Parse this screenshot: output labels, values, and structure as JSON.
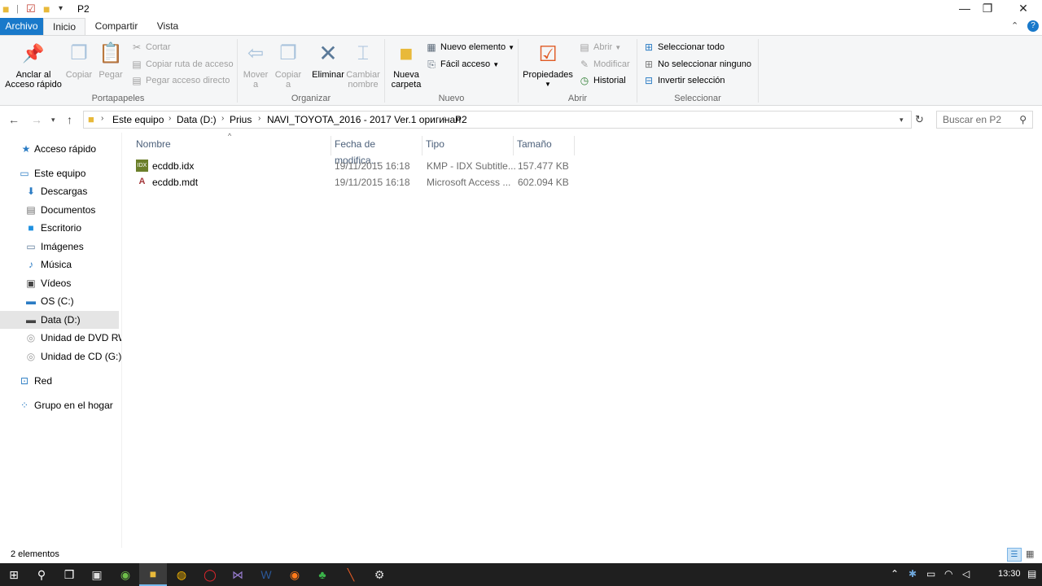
{
  "window": {
    "title": "P2",
    "minimize_icon": "minimize-icon",
    "maximize_icon": "restore-icon",
    "close_icon": "close-icon"
  },
  "tabs": [
    {
      "label": "Archivo"
    },
    {
      "label": "Inicio"
    },
    {
      "label": "Compartir"
    },
    {
      "label": "Vista"
    }
  ],
  "ribbon": {
    "portapapeles": {
      "label": "Portapapeles",
      "anclar": "Anclar al Acceso rápido",
      "anclar_l1": "Anclar al",
      "anclar_l2": "Acceso rápido",
      "copiar": "Copiar",
      "pegar": "Pegar",
      "cortar": "Cortar",
      "copiar_ruta": "Copiar ruta de acceso",
      "pegar_acceso": "Pegar acceso directo"
    },
    "organizar": {
      "label": "Organizar",
      "mover_l1": "Mover",
      "mover_l2": "a",
      "copiar_l1": "Copiar",
      "copiar_l2": "a",
      "eliminar": "Eliminar",
      "cambiar_l1": "Cambiar",
      "cambiar_l2": "nombre"
    },
    "nuevo": {
      "label": "Nuevo",
      "carpeta_l1": "Nueva",
      "carpeta_l2": "carpeta",
      "nuevo_elemento": "Nuevo elemento",
      "facil_acceso": "Fácil acceso"
    },
    "abrir": {
      "label": "Abrir",
      "propiedades": "Propiedades",
      "abrir": "Abrir",
      "modificar": "Modificar",
      "historial": "Historial"
    },
    "seleccionar": {
      "label": "Seleccionar",
      "todo": "Seleccionar todo",
      "ninguno": "No seleccionar ninguno",
      "invertir": "Invertir selección"
    }
  },
  "address": {
    "crumbs": [
      "Este equipo",
      "Data (D:)",
      "Prius",
      "NAVI_TOYOTA_2016 - 2017 Ver.1 оригинал",
      "P2"
    ],
    "search_placeholder": "Buscar en P2"
  },
  "sidebar": {
    "items": [
      {
        "label": "Acceso rápido",
        "icon": "star-icon"
      },
      {
        "label": "Este equipo",
        "icon": "computer-icon"
      },
      {
        "label": "Descargas",
        "icon": "download-icon"
      },
      {
        "label": "Documentos",
        "icon": "document-icon"
      },
      {
        "label": "Escritorio",
        "icon": "desktop-icon"
      },
      {
        "label": "Imágenes",
        "icon": "image-icon"
      },
      {
        "label": "Música",
        "icon": "music-icon"
      },
      {
        "label": "Vídeos",
        "icon": "video-icon"
      },
      {
        "label": "OS (C:)",
        "icon": "drive-icon"
      },
      {
        "label": "Data (D:)",
        "icon": "drive-icon"
      },
      {
        "label": "Unidad de DVD RW",
        "icon": "dvd-icon"
      },
      {
        "label": "Unidad de CD (G:)",
        "icon": "cd-icon"
      },
      {
        "label": "Red",
        "icon": "network-icon"
      },
      {
        "label": "Grupo en el hogar",
        "icon": "homegroup-icon"
      }
    ]
  },
  "columns": {
    "name": "Nombre",
    "date": "Fecha de modifica...",
    "type": "Tipo",
    "size": "Tamaño"
  },
  "files": [
    {
      "name": "ecddb.idx",
      "date": "19/11/2015 16:18",
      "type": "KMP - IDX Subtitle...",
      "size": "157.477 KB",
      "icon": "idx-file-icon"
    },
    {
      "name": "ecddb.mdt",
      "date": "19/11/2015 16:18",
      "type": "Microsoft Access ...",
      "size": "602.094 KB",
      "icon": "access-file-icon"
    }
  ],
  "status": {
    "count": "2 elementos"
  },
  "taskbar": {
    "time": "13:30"
  }
}
